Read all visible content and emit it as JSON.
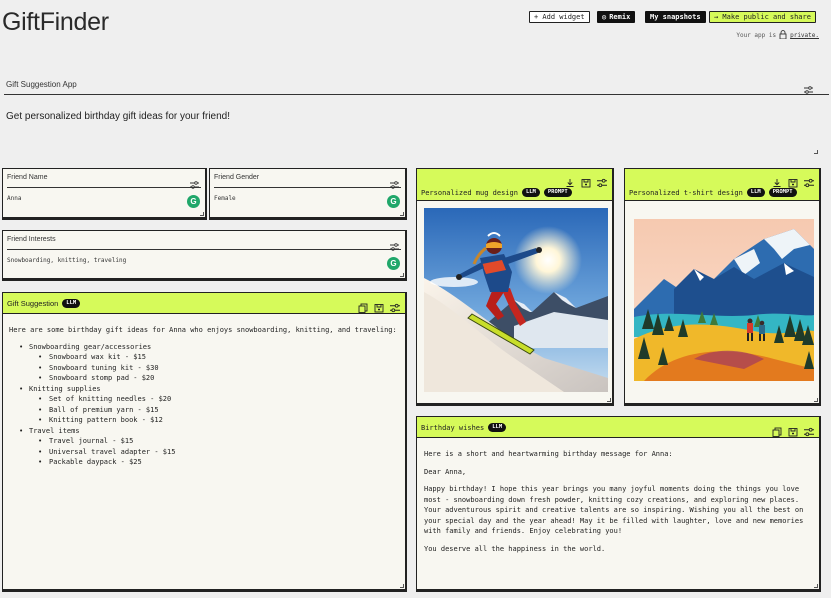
{
  "app": {
    "title": "GiftFinder"
  },
  "topbar": {
    "add_widget": "+ Add widget",
    "remix": "Remix",
    "snapshots": "My snapshots",
    "make_public": "→ Make public and share",
    "private_prefix": "Your app is",
    "private_link": "private."
  },
  "section": {
    "title": "Gift Suggestion App",
    "description": "Get personalized birthday gift ideas for your friend!"
  },
  "inputs": {
    "friend_name": {
      "label": "Friend Name",
      "value": "Anna"
    },
    "friend_gender": {
      "label": "Friend Gender",
      "value": "Female"
    },
    "friend_interests": {
      "label": "Friend Interests",
      "value": "Snowboarding, knitting, traveling"
    }
  },
  "gift_suggestion": {
    "title": "Gift Suggestion",
    "badge": "LLM",
    "intro": "Here are some birthday gift ideas for Anna who enjoys snowboarding, knitting, and traveling:",
    "groups": [
      {
        "name": "Snowboarding gear/accessories",
        "items": [
          "Snowboard wax kit - $15",
          "Snowboard tuning kit - $30",
          "Snowboard stomp pad - $20"
        ]
      },
      {
        "name": "Knitting supplies",
        "items": [
          "Set of knitting needles - $20",
          "Ball of premium yarn - $15",
          "Knitting pattern book - $12"
        ]
      },
      {
        "name": "Travel items",
        "items": [
          "Travel journal - $15",
          "Universal travel adapter - $15",
          "Packable daypack - $25"
        ]
      }
    ]
  },
  "mug": {
    "title": "Personalized mug design",
    "badge1": "LLM",
    "badge2": "PROMPT"
  },
  "tshirt": {
    "title": "Personalized t-shirt design",
    "badge1": "LLM",
    "badge2": "PROMPT"
  },
  "wishes": {
    "title": "Birthday wishes",
    "badge": "LLM",
    "paragraphs": [
      "Here is a short and heartwarming birthday message for Anna:",
      "Dear Anna,",
      "Happy birthday! I hope this year brings you many joyful moments doing the things you love most - snowboarding down fresh powder, knitting cozy creations, and exploring new places. Your adventurous spirit and creative talents are so inspiring. Wishing you all the best on your special day and the year ahead! May it be filled with laughter, love and new memories with family and friends. Enjoy celebrating you!",
      "You deserve all the happiness in the world."
    ]
  },
  "colors": {
    "accent": "#d6fa5a",
    "ink": "#111111",
    "panel": "#f8f7f1",
    "grammarly": "#20a76a"
  },
  "icons": [
    "settings-icon",
    "download-icon",
    "copy-icon",
    "save-icon",
    "grammarly-icon",
    "lock-icon",
    "remix-icon"
  ]
}
